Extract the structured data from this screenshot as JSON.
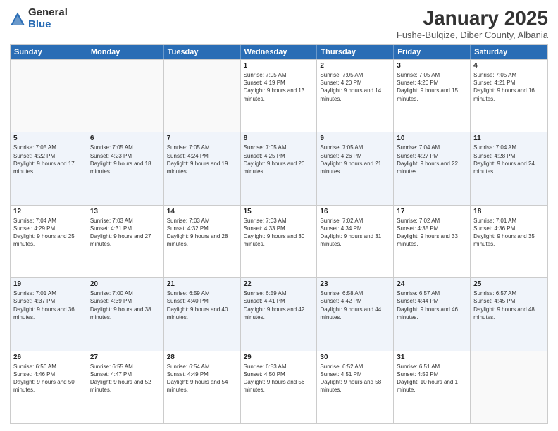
{
  "logo": {
    "general": "General",
    "blue": "Blue"
  },
  "header": {
    "month": "January 2025",
    "location": "Fushe-Bulqize, Diber County, Albania"
  },
  "weekdays": [
    "Sunday",
    "Monday",
    "Tuesday",
    "Wednesday",
    "Thursday",
    "Friday",
    "Saturday"
  ],
  "rows": [
    [
      {
        "day": "",
        "info": ""
      },
      {
        "day": "",
        "info": ""
      },
      {
        "day": "",
        "info": ""
      },
      {
        "day": "1",
        "info": "Sunrise: 7:05 AM\nSunset: 4:19 PM\nDaylight: 9 hours and 13 minutes."
      },
      {
        "day": "2",
        "info": "Sunrise: 7:05 AM\nSunset: 4:20 PM\nDaylight: 9 hours and 14 minutes."
      },
      {
        "day": "3",
        "info": "Sunrise: 7:05 AM\nSunset: 4:20 PM\nDaylight: 9 hours and 15 minutes."
      },
      {
        "day": "4",
        "info": "Sunrise: 7:05 AM\nSunset: 4:21 PM\nDaylight: 9 hours and 16 minutes."
      }
    ],
    [
      {
        "day": "5",
        "info": "Sunrise: 7:05 AM\nSunset: 4:22 PM\nDaylight: 9 hours and 17 minutes."
      },
      {
        "day": "6",
        "info": "Sunrise: 7:05 AM\nSunset: 4:23 PM\nDaylight: 9 hours and 18 minutes."
      },
      {
        "day": "7",
        "info": "Sunrise: 7:05 AM\nSunset: 4:24 PM\nDaylight: 9 hours and 19 minutes."
      },
      {
        "day": "8",
        "info": "Sunrise: 7:05 AM\nSunset: 4:25 PM\nDaylight: 9 hours and 20 minutes."
      },
      {
        "day": "9",
        "info": "Sunrise: 7:05 AM\nSunset: 4:26 PM\nDaylight: 9 hours and 21 minutes."
      },
      {
        "day": "10",
        "info": "Sunrise: 7:04 AM\nSunset: 4:27 PM\nDaylight: 9 hours and 22 minutes."
      },
      {
        "day": "11",
        "info": "Sunrise: 7:04 AM\nSunset: 4:28 PM\nDaylight: 9 hours and 24 minutes."
      }
    ],
    [
      {
        "day": "12",
        "info": "Sunrise: 7:04 AM\nSunset: 4:29 PM\nDaylight: 9 hours and 25 minutes."
      },
      {
        "day": "13",
        "info": "Sunrise: 7:03 AM\nSunset: 4:31 PM\nDaylight: 9 hours and 27 minutes."
      },
      {
        "day": "14",
        "info": "Sunrise: 7:03 AM\nSunset: 4:32 PM\nDaylight: 9 hours and 28 minutes."
      },
      {
        "day": "15",
        "info": "Sunrise: 7:03 AM\nSunset: 4:33 PM\nDaylight: 9 hours and 30 minutes."
      },
      {
        "day": "16",
        "info": "Sunrise: 7:02 AM\nSunset: 4:34 PM\nDaylight: 9 hours and 31 minutes."
      },
      {
        "day": "17",
        "info": "Sunrise: 7:02 AM\nSunset: 4:35 PM\nDaylight: 9 hours and 33 minutes."
      },
      {
        "day": "18",
        "info": "Sunrise: 7:01 AM\nSunset: 4:36 PM\nDaylight: 9 hours and 35 minutes."
      }
    ],
    [
      {
        "day": "19",
        "info": "Sunrise: 7:01 AM\nSunset: 4:37 PM\nDaylight: 9 hours and 36 minutes."
      },
      {
        "day": "20",
        "info": "Sunrise: 7:00 AM\nSunset: 4:39 PM\nDaylight: 9 hours and 38 minutes."
      },
      {
        "day": "21",
        "info": "Sunrise: 6:59 AM\nSunset: 4:40 PM\nDaylight: 9 hours and 40 minutes."
      },
      {
        "day": "22",
        "info": "Sunrise: 6:59 AM\nSunset: 4:41 PM\nDaylight: 9 hours and 42 minutes."
      },
      {
        "day": "23",
        "info": "Sunrise: 6:58 AM\nSunset: 4:42 PM\nDaylight: 9 hours and 44 minutes."
      },
      {
        "day": "24",
        "info": "Sunrise: 6:57 AM\nSunset: 4:44 PM\nDaylight: 9 hours and 46 minutes."
      },
      {
        "day": "25",
        "info": "Sunrise: 6:57 AM\nSunset: 4:45 PM\nDaylight: 9 hours and 48 minutes."
      }
    ],
    [
      {
        "day": "26",
        "info": "Sunrise: 6:56 AM\nSunset: 4:46 PM\nDaylight: 9 hours and 50 minutes."
      },
      {
        "day": "27",
        "info": "Sunrise: 6:55 AM\nSunset: 4:47 PM\nDaylight: 9 hours and 52 minutes."
      },
      {
        "day": "28",
        "info": "Sunrise: 6:54 AM\nSunset: 4:49 PM\nDaylight: 9 hours and 54 minutes."
      },
      {
        "day": "29",
        "info": "Sunrise: 6:53 AM\nSunset: 4:50 PM\nDaylight: 9 hours and 56 minutes."
      },
      {
        "day": "30",
        "info": "Sunrise: 6:52 AM\nSunset: 4:51 PM\nDaylight: 9 hours and 58 minutes."
      },
      {
        "day": "31",
        "info": "Sunrise: 6:51 AM\nSunset: 4:52 PM\nDaylight: 10 hours and 1 minute."
      },
      {
        "day": "",
        "info": ""
      }
    ]
  ]
}
